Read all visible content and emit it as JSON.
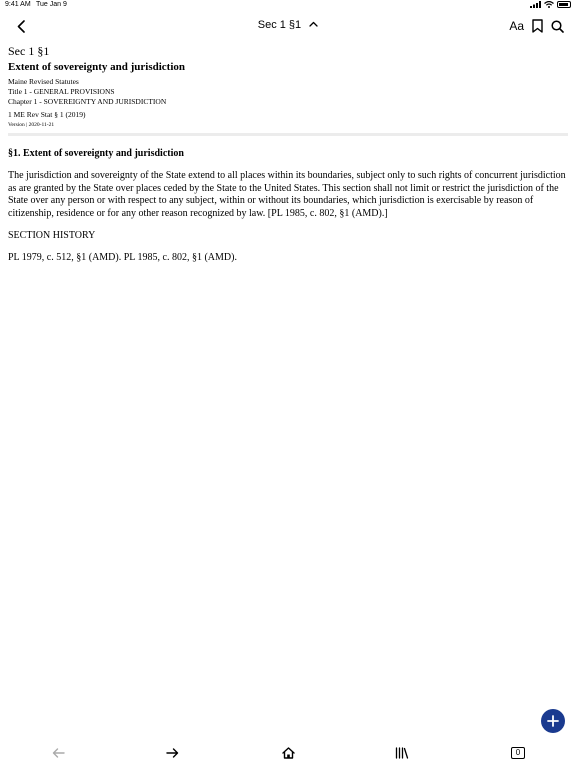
{
  "status_bar": {
    "time": "9:41 AM",
    "date": "Tue Jan 9"
  },
  "nav": {
    "title": "Sec 1 §1",
    "font_label": "Aa",
    "icons": [
      "chevron-left-icon",
      "chevron-up-icon",
      "bookmark-icon",
      "search-icon"
    ]
  },
  "document": {
    "section_label": "Sec 1 §1",
    "title": "Extent of sovereignty and jurisdiction",
    "source": "Maine Revised Statutes",
    "title_line": "Title 1 - GENERAL PROVISIONS",
    "chapter_line": "Chapter 1 - SOVEREIGNTY AND JURISDICTION",
    "citation": "1 ME Rev Stat § 1 (2019)",
    "version": "Version | 2020-11-21",
    "body_heading": "§1. Extent of sovereignty and jurisdiction",
    "body_text": "The jurisdiction and sovereignty of the State extend to all places within its boundaries, subject only to such rights of concurrent jurisdiction as are granted by the State over places ceded by the State to the United States. This section shall not limit or restrict the jurisdiction of the State over any person or with respect to any subject, within or without its boundaries, which jurisdiction is exercisable by reason of citizenship, residence or for any other reason recognized by law.   [PL 1985, c. 802, §1 (AMD).]",
    "history_heading": "SECTION HISTORY",
    "history_text": "PL 1979, c. 512, §1 (AMD). PL 1985, c. 802, §1 (AMD)."
  },
  "fab": {
    "icon": "plus-icon"
  },
  "tab_bar": {
    "tab_count": "0",
    "icons": [
      "arrow-left-icon",
      "arrow-right-icon",
      "home-icon",
      "library-icon",
      "tabs-icon"
    ]
  },
  "colors": {
    "accent": "#1a3a8f",
    "disabled": "#aaaaaa",
    "divider": "#ececec"
  }
}
